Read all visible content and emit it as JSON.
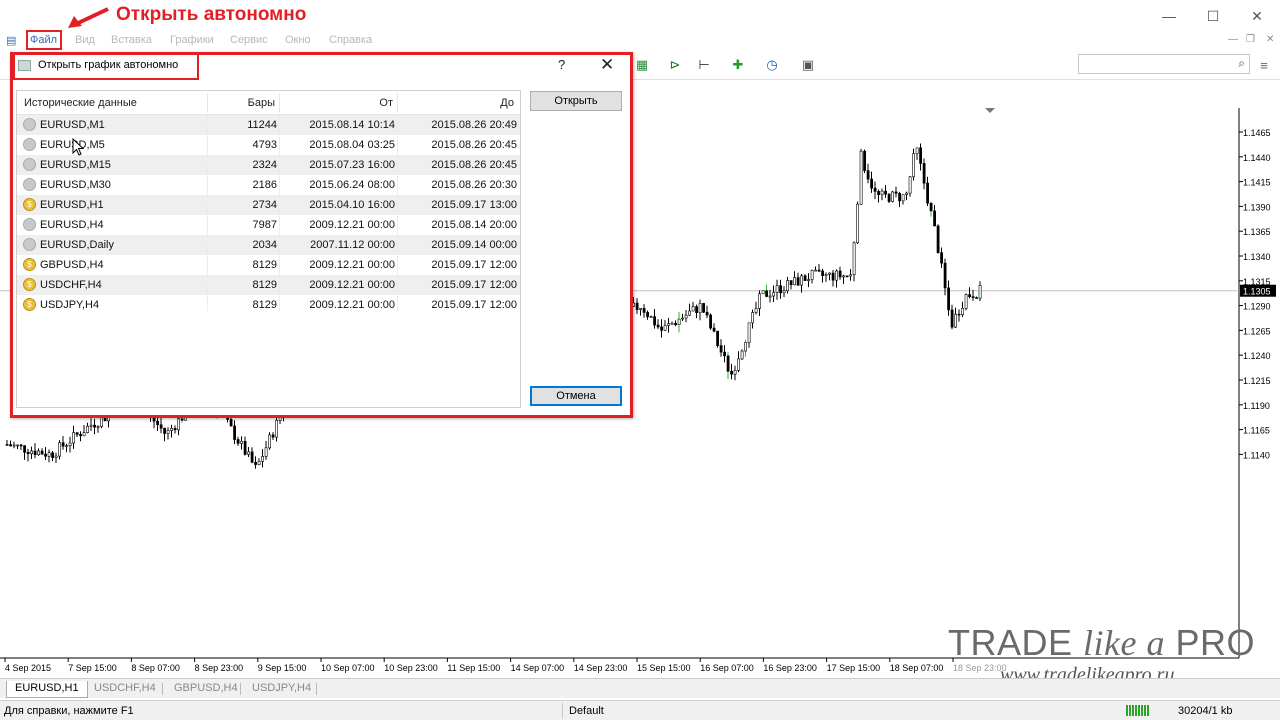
{
  "annotation": {
    "text": "Открыть автономно",
    "color": "#e31e24"
  },
  "menu": [
    "Файл",
    "Вид",
    "Вставка",
    "Графики",
    "Сервис",
    "Окно",
    "Справка"
  ],
  "dialog": {
    "title": "Открыть график автономно",
    "help": "?",
    "columns": [
      "Исторические данные",
      "Бары",
      "От",
      "До"
    ],
    "rows": [
      {
        "symbol": "EURUSD,M1",
        "bars": "11244",
        "from": "2015.08.14 10:14",
        "to": "2015.08.26 20:49",
        "icon": "gray"
      },
      {
        "symbol": "EURUSD,M5",
        "bars": "4793",
        "from": "2015.08.04 03:25",
        "to": "2015.08.26 20:45",
        "icon": "gray"
      },
      {
        "symbol": "EURUSD,M15",
        "bars": "2324",
        "from": "2015.07.23 16:00",
        "to": "2015.08.26 20:45",
        "icon": "gray"
      },
      {
        "symbol": "EURUSD,M30",
        "bars": "2186",
        "from": "2015.06.24 08:00",
        "to": "2015.08.26 20:30",
        "icon": "gray"
      },
      {
        "symbol": "EURUSD,H1",
        "bars": "2734",
        "from": "2015.04.10 16:00",
        "to": "2015.09.17 13:00",
        "icon": "gold"
      },
      {
        "symbol": "EURUSD,H4",
        "bars": "7987",
        "from": "2009.12.21 00:00",
        "to": "2015.08.14 20:00",
        "icon": "gray"
      },
      {
        "symbol": "EURUSD,Daily",
        "bars": "2034",
        "from": "2007.11.12 00:00",
        "to": "2015.09.14 00:00",
        "icon": "gray"
      },
      {
        "symbol": "GBPUSD,H4",
        "bars": "8129",
        "from": "2009.12.21 00:00",
        "to": "2015.09.17 12:00",
        "icon": "gold"
      },
      {
        "symbol": "USDCHF,H4",
        "bars": "8129",
        "from": "2009.12.21 00:00",
        "to": "2015.09.17 12:00",
        "icon": "gold"
      },
      {
        "symbol": "USDJPY,H4",
        "bars": "8129",
        "from": "2009.12.21 00:00",
        "to": "2015.09.17 12:00",
        "icon": "gold"
      }
    ],
    "open_button": "Открыть",
    "cancel_button": "Отмена"
  },
  "chart": {
    "price_labels": [
      "1.1465",
      "1.1440",
      "1.1415",
      "1.1390",
      "1.1365",
      "1.1340",
      "1.1315",
      "1.1290",
      "1.1265",
      "1.1240",
      "1.1215",
      "1.1190",
      "1.1165",
      "1.1140"
    ],
    "current_price": "1.1305",
    "time_labels": [
      "4 Sep 2015",
      "7 Sep 15:00",
      "8 Sep 07:00",
      "8 Sep 23:00",
      "9 Sep 15:00",
      "10 Sep 07:00",
      "10 Sep 23:00",
      "11 Sep 15:00",
      "14 Sep 07:00",
      "14 Sep 23:00",
      "15 Sep 15:00",
      "16 Sep 07:00",
      "16 Sep 23:00",
      "17 Sep 15:00",
      "18 Sep 07:00",
      "18 Sep 23:00"
    ]
  },
  "tabs": [
    "EURUSD,H1",
    "USDCHF,H4",
    "GBPUSD,H4",
    "USDJPY,H4"
  ],
  "status": {
    "help": "Для справки, нажмите F1",
    "profile": "Default",
    "traffic": "30204/1 kb"
  },
  "watermark": {
    "brand_a": "TRADE ",
    "brand_b": "like a",
    "brand_c": " PRO",
    "url": "www.tradelikeapro.ru"
  }
}
